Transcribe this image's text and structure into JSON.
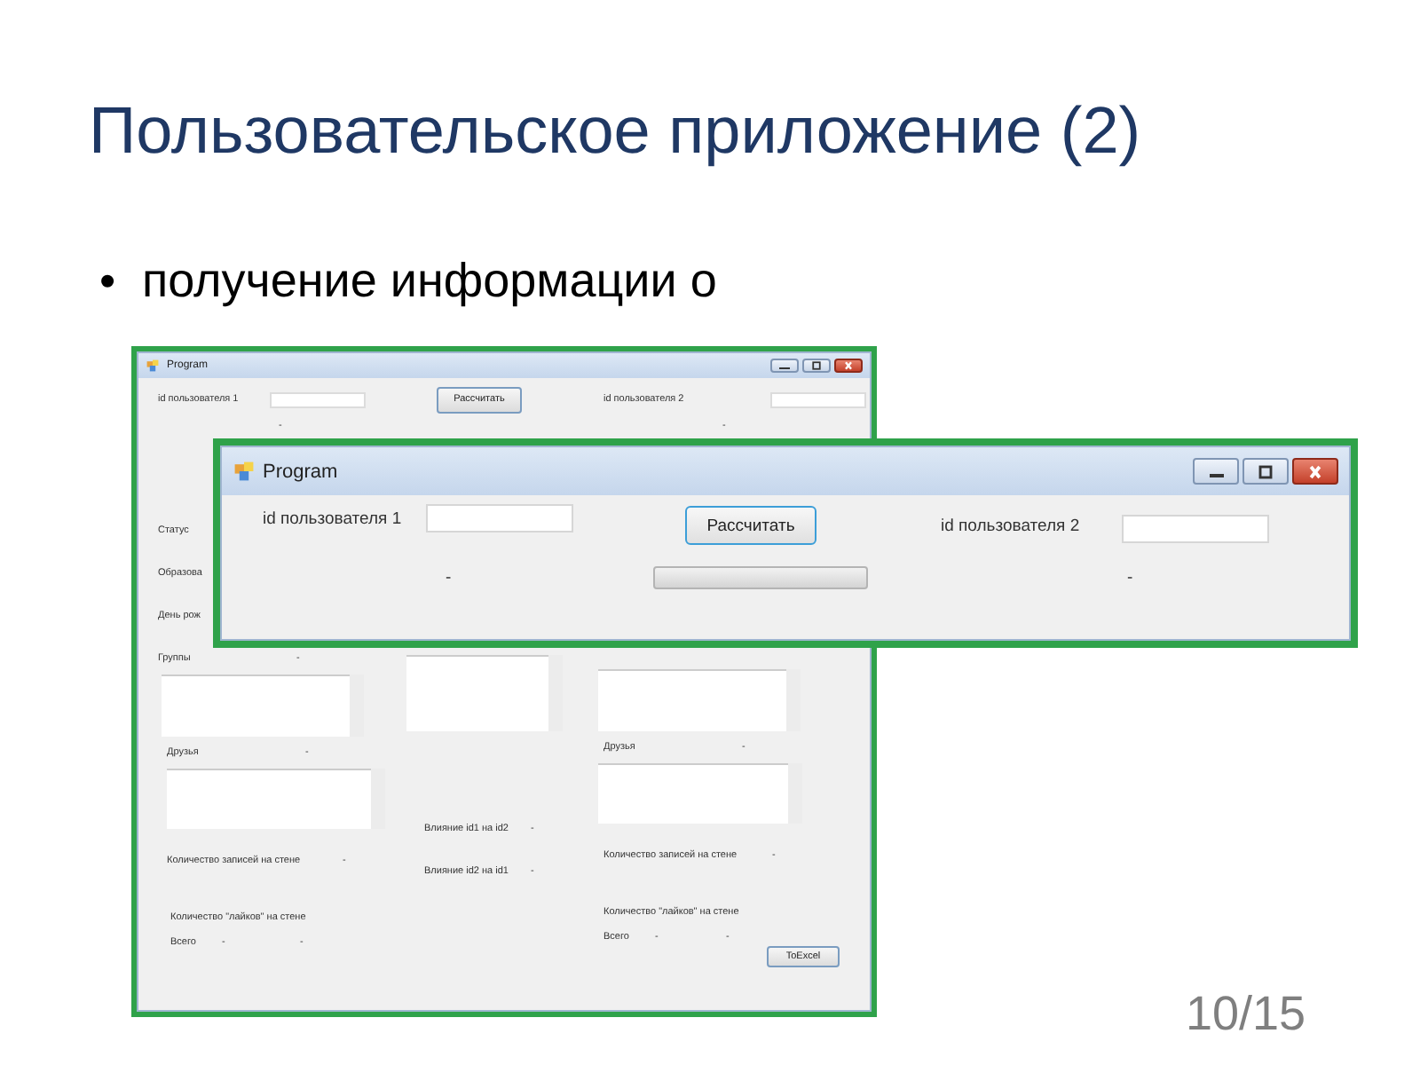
{
  "slide": {
    "title": "Пользовательское приложение (2)",
    "bullets": [
      {
        "marker": "•",
        "text": "получение информации о"
      }
    ],
    "page_number": "10/15"
  },
  "back_window": {
    "title": "Program",
    "user1_label": "id пользователя 1",
    "calc_button": "Рассчитать",
    "user2_label": "id пользователя 2",
    "user1_value": "-",
    "user2_value": "-",
    "left_labels": [
      "Статус",
      "Образова",
      "День рож"
    ],
    "groups": {
      "label": "Группы",
      "value": "-"
    },
    "sides": [
      {
        "friends_label": "Друзья",
        "friends_value": "-",
        "wall_label": "Количество записей на стене",
        "wall_value": "-",
        "likes_label": "Количество \"лайков\" на стене",
        "total_label": "Всего",
        "total_value": "-",
        "likes_value": "-"
      },
      {
        "friends_label": "Друзья",
        "friends_value": "-",
        "wall_label": "Количество записей на стене",
        "wall_value": "-",
        "likes_label": "Количество \"лайков\" на стене",
        "total_label": "Всего",
        "total_value": "-",
        "likes_value": "-"
      }
    ],
    "influence": [
      {
        "label": "Влияние id1 на id2",
        "value": "-"
      },
      {
        "label": "Влияние id2 на id1",
        "value": "-"
      }
    ],
    "excel_button": "ToExcel"
  },
  "front_window": {
    "title": "Program",
    "user1_label": "id пользователя 1",
    "calc_button": "Рассчитать",
    "user2_label": "id пользователя 2",
    "user1_value": "-",
    "user2_value": "-",
    "progress": {
      "level": 0
    }
  }
}
